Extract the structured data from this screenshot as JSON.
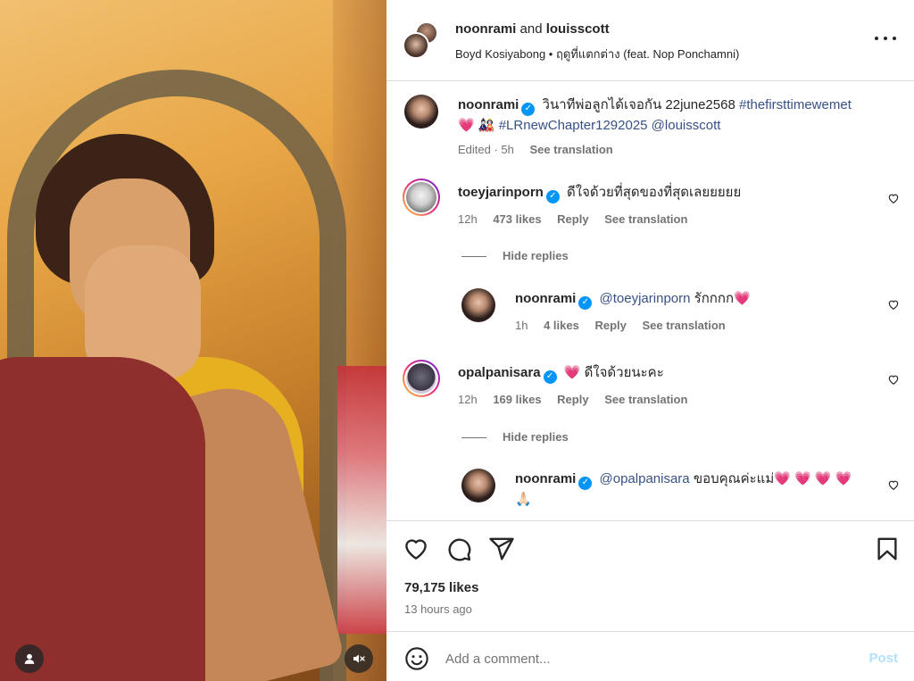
{
  "header": {
    "user1": "noonrami",
    "joiner": "and",
    "user2": "louisscott",
    "audio": "Boyd Kosiyabong • ฤดูที่แตกต่าง (feat. Nop Ponchamni)"
  },
  "caption": {
    "username": "noonrami",
    "text": "วินาทีพ่อลูกได้เจอกัน 22june2568",
    "hashtag1": "#thefirsttimewemet",
    "emojis": "💗 🎎",
    "hashtag2": "#LRnewChapter1292025",
    "mention": "@louisscott",
    "edited": "Edited · 5h",
    "see_translation": "See translation"
  },
  "comments": [
    {
      "username": "toeyjarinporn",
      "text": "ดีใจด้วยที่สุดของที่สุดเลยยยยย",
      "time": "12h",
      "likes": "473 likes",
      "reply": "Reply",
      "see_translation": "See translation",
      "hide_replies": "Hide replies",
      "replies": [
        {
          "username": "noonrami",
          "mention": "@toeyjarinporn",
          "text": "รักกกก💗",
          "time": "1h",
          "likes": "4 likes",
          "reply": "Reply",
          "see_translation": "See translation"
        }
      ]
    },
    {
      "username": "opalpanisara",
      "text": "💗 ดีใจด้วยนะคะ",
      "time": "12h",
      "likes": "169 likes",
      "reply": "Reply",
      "see_translation": "See translation",
      "hide_replies": "Hide replies",
      "replies": [
        {
          "username": "noonrami",
          "mention": "@opalpanisara",
          "text": "ขอบคุณค่ะแม่💗 💗 💗 💗",
          "text2": "🙏🏻"
        }
      ]
    }
  ],
  "stats": {
    "likes": "79,175 likes",
    "time_ago": "13 hours ago"
  },
  "composer": {
    "placeholder": "Add a comment...",
    "post": "Post"
  },
  "icons": {
    "heart": "heart-icon",
    "comment": "comment-icon",
    "share": "share-icon",
    "save": "bookmark-icon",
    "emoji": "emoji-icon",
    "more": "more-icon",
    "mute": "mute-icon",
    "user": "user-tag-icon",
    "verified": "verified-badge-icon"
  },
  "colors": {
    "link": "#385185",
    "verified": "#0095f6",
    "post_disabled": "#b2dffc",
    "muted_text": "#737373"
  }
}
